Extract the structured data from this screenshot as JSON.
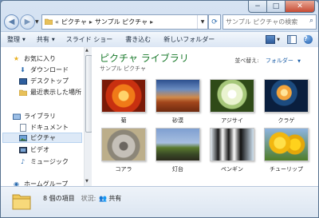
{
  "window": {
    "caption_buttons": {
      "minimize": "−",
      "maximize": "□",
      "close": "✕"
    }
  },
  "nav": {
    "back_icon": "back-arrow-icon",
    "forward_icon": "forward-arrow-icon",
    "breadcrumb_prefix": "«",
    "breadcrumb": [
      "ピクチャ",
      "サンプル ピクチャ"
    ],
    "breadcrumb_sep": "▸",
    "refresh_icon": "refresh-icon",
    "search_placeholder": "サンプル ピクチャの検索"
  },
  "toolbar": {
    "items": [
      {
        "label": "整理",
        "dropdown": true
      },
      {
        "label": "共有",
        "dropdown": true
      },
      {
        "label": "スライド ショー",
        "dropdown": false
      },
      {
        "label": "書き込む",
        "dropdown": false
      },
      {
        "label": "新しいフォルダー",
        "dropdown": false
      }
    ]
  },
  "sidebar": {
    "favorites_header": "お気に入り",
    "favorites": [
      "ダウンロード",
      "デスクトップ",
      "最近表示した場所"
    ],
    "libraries_header": "ライブラリ",
    "libraries": [
      "ドキュメント",
      "ピクチャ",
      "ビデオ",
      "ミュージック"
    ],
    "selected": "ピクチャ",
    "homegroup": "ホームグループ"
  },
  "main": {
    "library_title": "ピクチャ ライブラリ",
    "library_subtitle": "サンプル ピクチャ",
    "arrange_label": "並べ替え:",
    "arrange_value": "フォルダー",
    "thumbnails": [
      {
        "caption": "菊",
        "image": "chrysanthemum"
      },
      {
        "caption": "砂漠",
        "image": "desert"
      },
      {
        "caption": "アジサイ",
        "image": "hydrangeas"
      },
      {
        "caption": "クラゲ",
        "image": "jellyfish"
      },
      {
        "caption": "コアラ",
        "image": "koala"
      },
      {
        "caption": "灯台",
        "image": "lighthouse"
      },
      {
        "caption": "ペンギン",
        "image": "penguins"
      },
      {
        "caption": "チューリップ",
        "image": "tulips"
      }
    ]
  },
  "status": {
    "item_count": "8 個の項目",
    "state_label": "状況:",
    "state_value": "共有"
  },
  "colors": {
    "library_title": "#1a7a2c",
    "link_blue": "#1d5fa8",
    "selection": "#dde9f7"
  }
}
